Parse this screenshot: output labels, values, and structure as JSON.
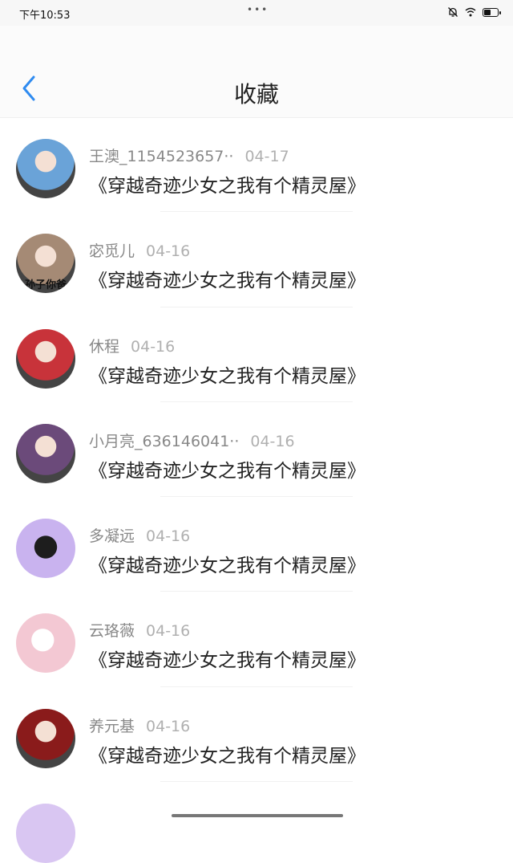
{
  "status": {
    "time": "下午10:53",
    "dots": "•••",
    "battery_level": 0.45
  },
  "nav": {
    "title": "收藏"
  },
  "items": [
    {
      "name": "王澳_1154523657··",
      "date": "04-17",
      "book": "《穿越奇迹少女之我有个精灵屋》",
      "avatar_color": "#6aa3d8"
    },
    {
      "name": "宓觅儿",
      "date": "04-16",
      "book": "《穿越奇迹少女之我有个精灵屋》",
      "avatar_color": "#a58a75",
      "avatar_caption": "孙子你爸"
    },
    {
      "name": "休程",
      "date": "04-16",
      "book": "《穿越奇迹少女之我有个精灵屋》",
      "avatar_color": "#c8333a"
    },
    {
      "name": "小月亮_636146041··",
      "date": "04-16",
      "book": "《穿越奇迹少女之我有个精灵屋》",
      "avatar_color": "#6b4a7a"
    },
    {
      "name": "多凝远",
      "date": "04-16",
      "book": "《穿越奇迹少女之我有个精灵屋》",
      "avatar_color": "#c9b3ef"
    },
    {
      "name": "云珞薇",
      "date": "04-16",
      "book": "《穿越奇迹少女之我有个精灵屋》",
      "avatar_color": "#f3c8d3"
    },
    {
      "name": "养元基",
      "date": "04-16",
      "book": "《穿越奇迹少女之我有个精灵屋》",
      "avatar_color": "#8a1b1b"
    }
  ],
  "colors": {
    "accent": "#2f8bf0",
    "name_gray": "#888888",
    "date_gray": "#b0b0b0"
  }
}
